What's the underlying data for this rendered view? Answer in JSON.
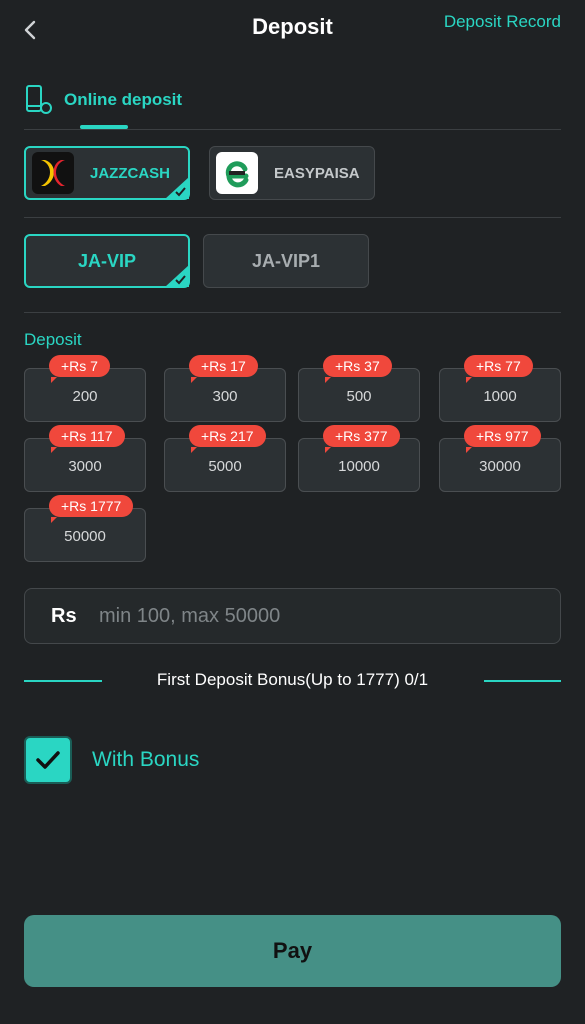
{
  "header": {
    "title": "Deposit",
    "record_link": "Deposit Record"
  },
  "tabs": {
    "online": "Online deposit"
  },
  "payment_methods": [
    {
      "label": "JAZZCASH",
      "selected": true,
      "icon": "jazzcash-logo"
    },
    {
      "label": "EASYPAISA",
      "selected": false,
      "icon": "easypaisa-logo"
    }
  ],
  "channels": [
    {
      "label": "JA-VIP",
      "selected": true
    },
    {
      "label": "JA-VIP1",
      "selected": false
    }
  ],
  "deposit": {
    "label": "Deposit",
    "amounts": [
      {
        "value": "200",
        "bonus": "+Rs 7"
      },
      {
        "value": "300",
        "bonus": "+Rs 17"
      },
      {
        "value": "500",
        "bonus": "+Rs 37"
      },
      {
        "value": "1000",
        "bonus": "+Rs 77"
      },
      {
        "value": "3000",
        "bonus": "+Rs 117"
      },
      {
        "value": "5000",
        "bonus": "+Rs 217"
      },
      {
        "value": "10000",
        "bonus": "+Rs 377"
      },
      {
        "value": "30000",
        "bonus": "+Rs 977"
      },
      {
        "value": "50000",
        "bonus": "+Rs 1777"
      }
    ]
  },
  "amount_input": {
    "currency": "Rs",
    "placeholder": "min 100, max 50000",
    "value": ""
  },
  "bonus": {
    "title": "First Deposit Bonus(Up to 1777)  0/1",
    "with_bonus_label": "With Bonus",
    "checked": true
  },
  "pay_button": "Pay",
  "colors": {
    "accent": "#2ad6c3",
    "badge": "#f0483c",
    "pay": "#459086",
    "background": "#1f2224"
  }
}
